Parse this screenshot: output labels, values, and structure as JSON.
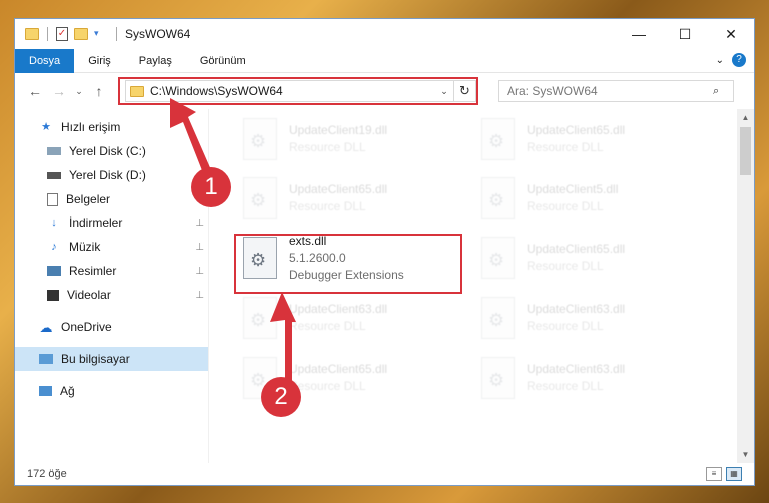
{
  "window": {
    "title": "SysWOW64",
    "controls": {
      "minimize": "—",
      "maximize": "☐",
      "close": "✕"
    }
  },
  "ribbon": {
    "tabs": [
      "Dosya",
      "Giriş",
      "Paylaş",
      "Görünüm"
    ],
    "active_tab": "Dosya",
    "expand": "⌄",
    "help": "?"
  },
  "nav": {
    "back": "←",
    "forward": "→",
    "recent": "⌄",
    "up": "↑",
    "address": "C:\\Windows\\SysWOW64",
    "address_dropdown": "⌄",
    "refresh": "↻",
    "search_placeholder": "Ara: SysWOW64",
    "search_icon": "⌕"
  },
  "sidebar": {
    "quick_access": "Hızlı erişim",
    "items": [
      {
        "label": "Yerel Disk (C:)",
        "icon": "drive-icon",
        "pinned": true
      },
      {
        "label": "Yerel Disk (D:)",
        "icon": "drive-icon",
        "pinned": false
      },
      {
        "label": "Belgeler",
        "icon": "documents-icon",
        "pinned": false
      },
      {
        "label": "İndirmeler",
        "icon": "download-icon",
        "pinned": true
      },
      {
        "label": "Müzik",
        "icon": "music-icon",
        "pinned": true
      },
      {
        "label": "Resimler",
        "icon": "pictures-icon",
        "pinned": true
      },
      {
        "label": "Videolar",
        "icon": "videos-icon",
        "pinned": true
      }
    ],
    "onedrive": "OneDrive",
    "this_pc": "Bu bilgisayar",
    "network": "Ağ",
    "pin_glyph": "📌"
  },
  "files": {
    "left_column": [
      {
        "name": "UpdateClient19.dll",
        "sub": "Resource DLL"
      },
      {
        "name": "UpdateClient65.dll",
        "sub": "Resource DLL"
      },
      {
        "name": "exts.dll",
        "sub": "5.1.2600.0",
        "sub2": "Debugger Extensions"
      },
      {
        "name": "UpdateClient63.dll",
        "sub": "Resource DLL"
      },
      {
        "name": "UpdateClient65.dll",
        "sub": "Resource DLL"
      }
    ],
    "right_column": [
      {
        "name": "UpdateClient65.dll",
        "sub": "Resource DLL"
      },
      {
        "name": "UpdateClient5.dll",
        "sub": "Resource DLL"
      },
      {
        "name": "UpdateClient65.dll",
        "sub": "Resource DLL"
      },
      {
        "name": "UpdateClient63.dll",
        "sub": "Resource DLL"
      },
      {
        "name": "UpdateClient63.dll",
        "sub": "Resource DLL"
      }
    ]
  },
  "status": {
    "count": "172 öğe"
  },
  "annotations": {
    "marker1": "1",
    "marker2": "2",
    "color": "#d8333b"
  },
  "colors": {
    "accent": "#1979ca",
    "selection": "#cce4f7"
  }
}
